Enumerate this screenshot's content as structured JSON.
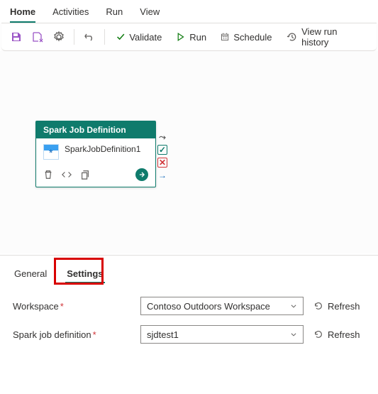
{
  "top_tabs": {
    "home": "Home",
    "activities": "Activities",
    "run": "Run",
    "view": "View"
  },
  "toolbar": {
    "validate": "Validate",
    "run": "Run",
    "schedule": "Schedule",
    "history": "View run history"
  },
  "card": {
    "title": "Spark Job Definition",
    "name": "SparkJobDefinition1"
  },
  "lower_tabs": {
    "general": "General",
    "settings": "Settings"
  },
  "form": {
    "workspace": {
      "label": "Workspace",
      "value": "Contoso Outdoors Workspace",
      "refresh": "Refresh"
    },
    "sjd": {
      "label": "Spark job definition",
      "value": "sjdtest1",
      "refresh": "Refresh"
    }
  }
}
